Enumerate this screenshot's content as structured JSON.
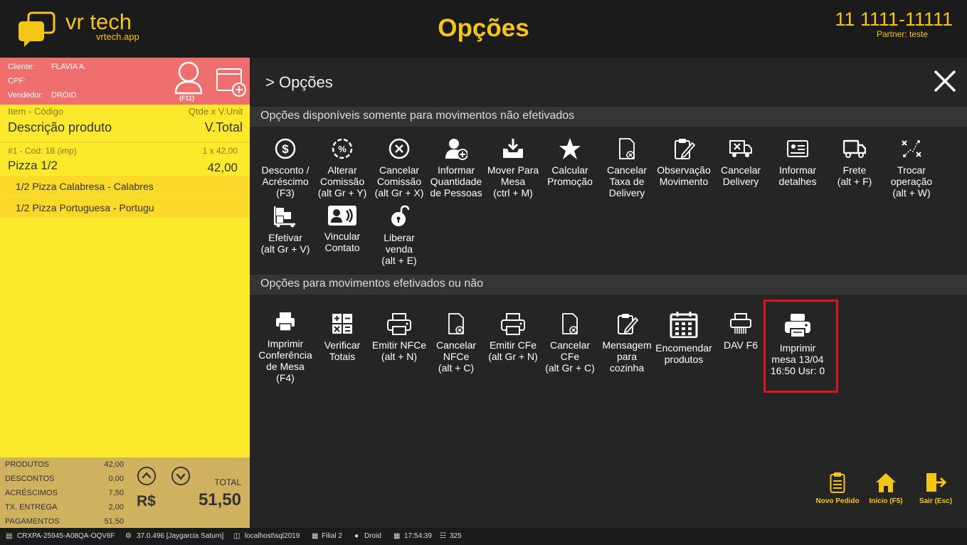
{
  "header": {
    "brand": "vr tech",
    "brand_sub": "vrtech.app",
    "title": "Opções",
    "phone": "11 1111-11111",
    "partner": "Partner: teste"
  },
  "customer": {
    "cliente_label": "Cliente:",
    "cliente_value": "FLAVIA A.",
    "cpf_label": "CPF:",
    "cpf_value": "",
    "vendedor_label": "Vendedor:",
    "vendedor_value": "DROID",
    "f11_label": "(F11)"
  },
  "cart": {
    "header_item": "Item - Código",
    "header_qty": "Qtde x V.Unit",
    "header_desc": "Descrição produto",
    "header_total": "V.Total",
    "items": [
      {
        "code": "#1 - Cod: 18 (imp)",
        "qty": "1 x 42,00",
        "name": "Pizza 1/2",
        "total": "42,00",
        "subitems": [
          "1/2 Pizza Calabresa - Calabres",
          "1/2 Pizza Portuguesa - Portugu"
        ]
      }
    ]
  },
  "totals": {
    "rows": [
      {
        "label": "PRODUTOS",
        "value": "42,00"
      },
      {
        "label": "DESCONTOS",
        "value": "0,00"
      },
      {
        "label": "ACRÉSCIMOS",
        "value": "7,50"
      },
      {
        "label": "TX. ENTREGA",
        "value": "2,00"
      },
      {
        "label": "PAGAMENTOS",
        "value": "51,50"
      }
    ],
    "currency": "R$",
    "total_label": "TOTAL",
    "total_value": "51,50"
  },
  "main": {
    "breadcrumb": "> Opções",
    "section1": "Opções disponíveis somente para movimentos não efetivados",
    "section2": "Opções para movimentos efetivados ou não",
    "options1": [
      {
        "icon": "dollar-circle-icon",
        "lines": [
          "Desconto /",
          "Acréscimo",
          "(F3)"
        ]
      },
      {
        "icon": "percent-circle-icon",
        "lines": [
          "Alterar",
          "Comissão",
          "(alt Gr + Y)"
        ]
      },
      {
        "icon": "x-circle-icon",
        "lines": [
          "Cancelar",
          "Comissão",
          "(alt Gr + X)"
        ]
      },
      {
        "icon": "add-person-icon",
        "lines": [
          "Informar",
          "Quantidade",
          "de Pessoas"
        ]
      },
      {
        "icon": "move-tray-icon",
        "lines": [
          "Mover Para",
          "Mesa",
          "(ctrl + M)"
        ]
      },
      {
        "icon": "star-icon",
        "lines": [
          "Calcular",
          "Promoção"
        ]
      },
      {
        "icon": "doc-cancel-icon",
        "lines": [
          "Cancelar",
          "Taxa de",
          "Delivery"
        ]
      },
      {
        "icon": "clipboard-pen-icon",
        "lines": [
          "Observação",
          "Movimento"
        ]
      },
      {
        "icon": "truck-cancel-icon",
        "lines": [
          "Cancelar",
          "Delivery"
        ]
      },
      {
        "icon": "id-card-icon",
        "lines": [
          "Informar",
          "detalhes"
        ]
      },
      {
        "icon": "truck-icon",
        "lines": [
          "Frete",
          "(alt + F)"
        ]
      },
      {
        "icon": "swap-route-icon",
        "lines": [
          "Trocar",
          "operação",
          "(alt + W)"
        ]
      },
      {
        "icon": "boxes-dolly-icon",
        "lines": [
          "Efetivar",
          "(alt Gr + V)"
        ]
      },
      {
        "icon": "contact-card-icon",
        "lines": [
          "Vincular",
          "Contato"
        ]
      },
      {
        "icon": "unlock-icon",
        "lines": [
          "Liberar",
          "venda",
          "(alt + E)"
        ]
      }
    ],
    "options2": [
      {
        "icon": "printer-small-icon",
        "lines": [
          "Imprimir",
          "Conferência",
          "de Mesa",
          "(F4)"
        ]
      },
      {
        "icon": "calculator-icon",
        "lines": [
          "Verificar",
          "Totais"
        ]
      },
      {
        "icon": "printer-icon",
        "lines": [
          "Emitir NFCe",
          "(alt + N)"
        ]
      },
      {
        "icon": "doc-cancel-icon",
        "lines": [
          "Cancelar",
          "NFCe",
          "(alt + C)"
        ]
      },
      {
        "icon": "printer-icon",
        "lines": [
          "Emitir CFe",
          "(alt Gr + N)"
        ]
      },
      {
        "icon": "doc-cancel-icon",
        "lines": [
          "Cancelar",
          "CFe",
          "(alt Gr + C)"
        ]
      },
      {
        "icon": "clipboard-pen-icon",
        "lines": [
          "Mensagem",
          "para",
          "cozinha"
        ]
      },
      {
        "icon": "calendar-icon",
        "lines": [
          "Encomendar",
          "produtos"
        ]
      },
      {
        "icon": "shredder-printer-icon",
        "lines": [
          "DAV F6"
        ]
      },
      {
        "icon": "printer-filled-icon",
        "lines": [
          "Imprimir",
          "mesa 13/04",
          "16:50 Usr: 0"
        ]
      }
    ],
    "bottom_buttons": [
      {
        "icon": "clipboard-list-icon",
        "label": "Novo Pedido"
      },
      {
        "icon": "home-icon",
        "label": "Início (F5)"
      },
      {
        "icon": "exit-door-icon",
        "label": "Sair (Esc)"
      }
    ]
  },
  "status": {
    "terminal": "CRXPA-25945-A08QA-OQV6F",
    "version": "37.0.496 [Jaygarcia Saturn]",
    "database": "localhost\\sql2019",
    "branch": "Filial 2",
    "user": "Droid",
    "time": "17:54:39",
    "cart_count": "325"
  },
  "colors": {
    "accent": "#f5c518",
    "customer_bar": "#ef6f6f",
    "cart_bg": "#fde92b",
    "totals_bg": "#cfb25f",
    "highlight": "#e0141a"
  }
}
